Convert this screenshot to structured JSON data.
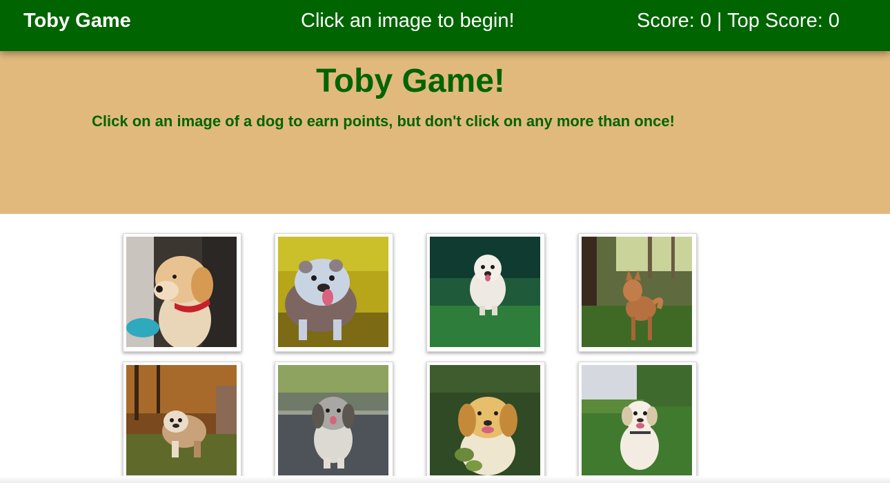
{
  "navbar": {
    "brand": "Toby Game",
    "message": "Click an image to begin!",
    "score_text": "Score: 0 | Top Score: 0"
  },
  "jumbotron": {
    "title": "Toby Game!",
    "subtitle": "Click on an image of a dog to earn points, but don't click on any more than once!"
  },
  "cards": [
    {
      "icon": "golden-puppy-photo"
    },
    {
      "icon": "bulldog-photo"
    },
    {
      "icon": "white-fluffy-dog-photo"
    },
    {
      "icon": "shiba-dog-in-forest-photo"
    },
    {
      "icon": "bulldog-in-autumn-leaves-photo"
    },
    {
      "icon": "shih-tzu-on-road-photo"
    },
    {
      "icon": "golden-retriever-photo"
    },
    {
      "icon": "labrador-in-grass-photo"
    }
  ],
  "colors": {
    "navbar": "#006400",
    "jumbotron": "#e2b97d",
    "heading_text": "#006400"
  }
}
